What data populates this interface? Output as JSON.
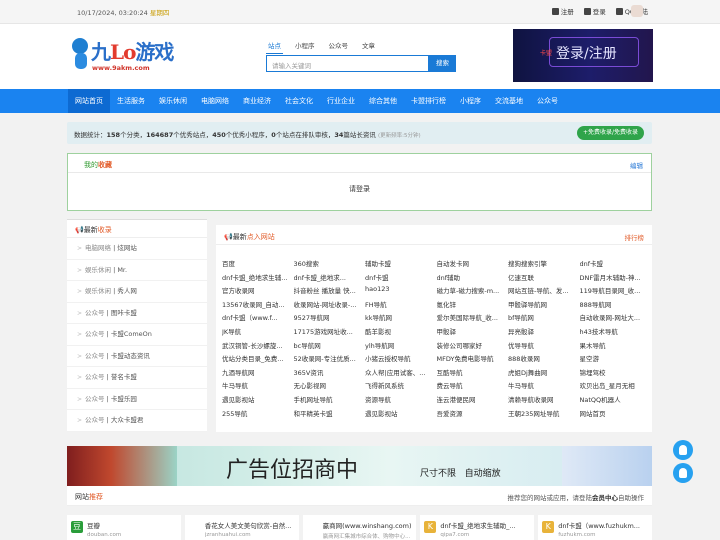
{
  "topbar": {
    "datetime": "10/17/2024, 03:20:24",
    "weekday": "星期四",
    "register": "注册",
    "login": "登录",
    "qq_login": "QQ登陆"
  },
  "logo": {
    "name_blue": "九",
    "name_red": "Lo",
    "name_rest": "游戏",
    "url": "www.9akm.com"
  },
  "search": {
    "tabs": [
      "站点",
      "小程序",
      "公众号",
      "文章"
    ],
    "placeholder": "请输入关键词",
    "button": "搜索"
  },
  "banner": {
    "tag": "卡盟",
    "text": "登录/注册"
  },
  "nav": [
    "网站首页",
    "生活服务",
    "娱乐休闲",
    "电脑网络",
    "商业经济",
    "社会文化",
    "行业企业",
    "综合其他",
    "卡盟排行榜",
    "小程序",
    "交流基地",
    "公众号"
  ],
  "stats": {
    "prefix": "数据统计：",
    "cats": "158",
    "cats_label": "个分类，",
    "sites": "164687",
    "sites_label": "个优秀站点，",
    "apps": "450",
    "apps_label": "个优秀小程序，",
    "pending": "0",
    "pending_label": "个站点在排队审核，",
    "articles": "34",
    "articles_label": "篇站长资讯",
    "refresh": "(更新频率:5分钟)",
    "add_button": "+免费收录/免费收录"
  },
  "favorites": {
    "title_a": "我的",
    "title_b": "收藏",
    "edit": "编辑",
    "login_prompt": "请登录"
  },
  "latest": {
    "title_a": "最新",
    "title_b": "收录",
    "items": [
      {
        "cat": "电脑网络",
        "name": "炫网站"
      },
      {
        "cat": "娱乐休闲",
        "name": "Mr."
      },
      {
        "cat": "娱乐休闲",
        "name": "秀人网"
      },
      {
        "cat": "公众号",
        "name": "图咔卡盟"
      },
      {
        "cat": "公众号",
        "name": "卡盟ComeOn"
      },
      {
        "cat": "公众号",
        "name": "卡盟动态资讯"
      },
      {
        "cat": "公众号",
        "name": "誉名卡盟"
      },
      {
        "cat": "公众号",
        "name": "卡盟乐园"
      },
      {
        "cat": "公众号",
        "name": "大众卡盟君"
      }
    ]
  },
  "clicks": {
    "title_a": "最新",
    "title_b": "点入网站",
    "rank": "排行榜",
    "items": [
      "百度",
      "360搜索",
      "辅助卡盟",
      "自动发卡网",
      "搜狗搜索引擎",
      "dnf卡盟",
      "dnf卡盟_绝地求生辅...",
      "dnf卡盟_绝地求...",
      "dnf卡盟",
      "dnf辅助",
      "亿速互联",
      "DNF雷月木辅助-神...",
      "官方收录网",
      "抖音粉丝 播放量 快...",
      "hao123",
      "磁力草-磁力搜索-m...",
      "网站互链-导航、发...",
      "119导航目录网_收...",
      "13567收录网_自动...",
      "收录网站-网址收录-...",
      "FH导航",
      "氪化锌",
      "甲骰驿导航网",
      "888导航网",
      "dnf卡盟（www.f...",
      "9527导航网",
      "kk导航网",
      "爱尔美国际导航_收...",
      "bf导航网",
      "自动收录网-网址大...",
      "JK导航",
      "17175游戏网址收...",
      "酷羊影视",
      "甲骰驿",
      "异亮骰驿",
      "h43技术导航",
      "武汉铜管-长沙螺旋...",
      "bc导航网",
      "ylh导航网",
      "装修公司哪家好",
      "优导导航",
      "果木导航",
      "优站分类目录_免费...",
      "52收录网-专注优质...",
      "小猪云授权导航",
      "MFDY免费电影导航",
      "888收录网",
      "星空游",
      "九酒导航网",
      "365V资讯",
      "众人帮|应用试客、...",
      "互酷导航",
      "虎姐Dj舞曲网",
      "锦埋驾校",
      "牛马导航",
      "无心影视网",
      "飞得新风系统",
      "费云导航",
      "牛马导航",
      "欢贝出岛_星月无相",
      "遇见影视站",
      "手机网址导航",
      "资源导航",
      "连云港便民网",
      "清赖导航收录网",
      "NatQQ机器人",
      "255导航",
      "和平精英卡盟",
      "遇见影视站",
      "吾爱资源",
      "王朝235网址导航",
      "网站首页"
    ]
  },
  "ad": {
    "headline": "广告位招商中",
    "sub1": "尺寸不限",
    "sub2": "自动缩放"
  },
  "recommend": {
    "title_a": "网站",
    "title_b": "推荐",
    "note_a": "推荐您的网站或应用，请登陆",
    "note_b": "会员中心",
    "note_c": "自助操作"
  },
  "cards": [
    {
      "name": "豆瓣",
      "url": "douban.com"
    },
    {
      "name": "香花女人美文美句欣赏-自然...",
      "url": "jzranhuahui.com"
    },
    {
      "name": "赢商网(www.winshang.com)",
      "url": "赢商网汇集城市综合体、购物中心..."
    },
    {
      "name": "dnf卡盟_绝地求生辅助_...",
      "url": "qipa7.com"
    },
    {
      "name": "dnf卡盟（www.fuzhukm...",
      "url": "fuzhukm.com"
    }
  ],
  "colors": {
    "nav_blue": "#1a83f0",
    "accent_orange": "#e25c2a",
    "green": "#2fa44a"
  }
}
